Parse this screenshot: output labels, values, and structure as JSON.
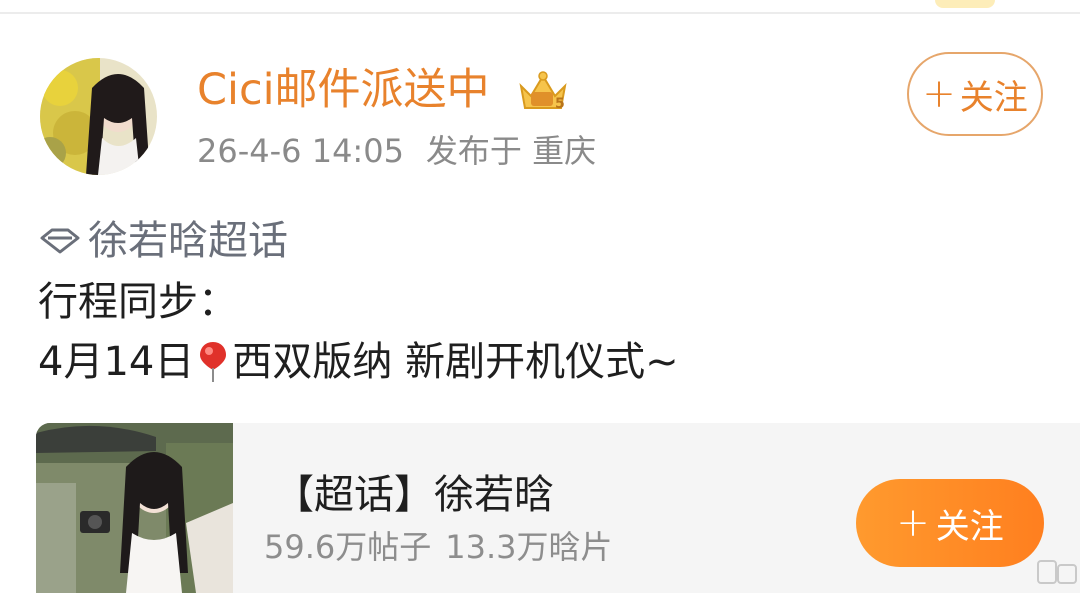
{
  "post": {
    "username": "Cici邮件派送中",
    "badge_icon": "crown-badge-icon",
    "date": "26-4-6 14:05",
    "location": "发布于 重庆",
    "follow_plus": "+",
    "follow_label": "关注"
  },
  "body": {
    "topic": "徐若晗超话",
    "line1": "行程同步：",
    "line2_prefix": "4月14日",
    "line2_icon": "location-pin-icon",
    "line2_suffix": "西双版纳 新剧开机仪式~"
  },
  "card": {
    "title": "【超话】徐若晗",
    "posts": "59.6万帖子",
    "photos": "13.3万晗片",
    "follow_plus": "+",
    "follow_label": "关注"
  },
  "colors": {
    "accent_orange": "#e8822c",
    "button_gradient_start": "#ff9a2e",
    "button_gradient_end": "#ff7f1f",
    "topic_gray": "#6a6f7a",
    "card_bg": "#f5f5f5"
  }
}
